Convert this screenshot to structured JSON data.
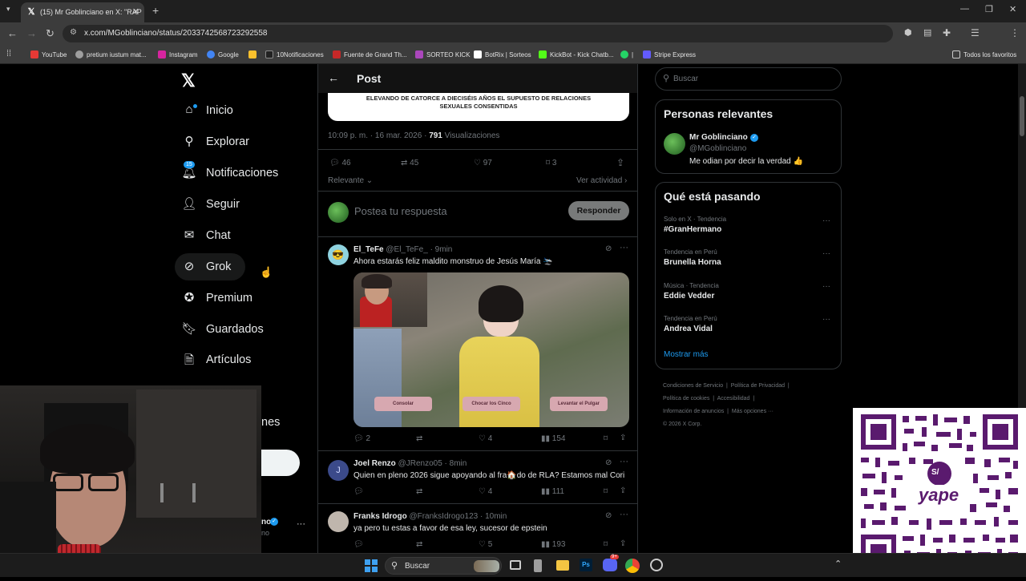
{
  "browser": {
    "tab_title": "(15) Mr Goblinciano en X: \"RAP",
    "url": "x.com/MGoblinciano/status/2033742568723292558",
    "bookmarks": [
      "YouTube",
      "pretium iustum mat...",
      "Instagram",
      "Google",
      "10Notificaciones",
      "Fuente de Grand Th...",
      "SORTEO KICK",
      "BotRix | Sorteos",
      "KickBot - Kick Chatb...",
      "Stripe Express"
    ],
    "bookmarks_folder": "Todos los favoritos"
  },
  "nav": {
    "items": [
      "Inicio",
      "Explorar",
      "Notificaciones",
      "Seguir",
      "Chat",
      "Grok",
      "Premium",
      "Guardados",
      "Artículos"
    ],
    "notif_count": "15",
    "partial_more": "nes",
    "profile_suffix": "no",
    "profile_sub": "no",
    "more_dots": "···"
  },
  "post": {
    "header": "Post",
    "image_text": "ELEVANDO DE CATORCE A DIECISÉIS AÑOS EL SUPUESTO DE RELACIONES SEXUALES CONSENTIDAS",
    "meta_time": "10:09 p. m. · 16 mar. 2026 · ",
    "views_count": "791",
    "views_label": "Visualizaciones",
    "replies": "46",
    "reposts": "45",
    "likes": "97",
    "bookmarks": "3",
    "sort_label": "Relevante",
    "activity_label": "Ver actividad",
    "reply_placeholder": "Postea tu respuesta",
    "reply_button": "Responder"
  },
  "replies": [
    {
      "name": "El_TeFe",
      "handle": "@El_TeFe_ · 9min",
      "text": "Ahora estarás feliz maldito monstruo de Jesús María 🛬",
      "media_buttons": [
        "Consolar",
        "Chocar los Cinco",
        "Levantar el Pulgar"
      ],
      "replies": "2",
      "reposts": "",
      "likes": "4",
      "views": "154"
    },
    {
      "name": "Joel Renzo",
      "handle": "@JRenzo05 · 8min",
      "text": "Quien en pleno 2026 sigue apoyando al fra🏠do de RLA? Estamos mal Cori",
      "replies": "",
      "reposts": "",
      "likes": "4",
      "views": "111"
    },
    {
      "name": "Franks Idrogo",
      "handle": "@FranksIdrogo123 · 10min",
      "text": "ya pero tu estas a favor de esa ley, sucesor de epstein",
      "replies": "",
      "reposts": "",
      "likes": "5",
      "views": "193"
    }
  ],
  "sidebar": {
    "search_placeholder": "Buscar",
    "relevant_title": "Personas relevantes",
    "person_name": "Mr Goblinciano",
    "person_handle": "@MGoblinciano",
    "person_bio": "Me odian por decir la verdad 👍",
    "trends_title": "Qué está pasando",
    "trends": [
      {
        "context": "Solo en X · Tendencia",
        "name": "#GranHermano"
      },
      {
        "context": "Tendencia en Perú",
        "name": "Brunella Horna"
      },
      {
        "context": "Música · Tendencia",
        "name": "Eddie Vedder"
      },
      {
        "context": "Tendencia en Perú",
        "name": "Andrea Vidal"
      }
    ],
    "show_more": "Mostrar más",
    "footer": [
      "Condiciones de Servicio",
      "Política de Privacidad",
      "Política de cookies",
      "Accesibilidad",
      "Información de anuncios",
      "Más opciones ···",
      "© 2026 X Corp."
    ]
  },
  "taskbar": {
    "search": "Buscar",
    "discord_badge": "9+"
  },
  "overlay": {
    "qr_brand": "yape",
    "qr_currency": "S/"
  },
  "colors": {
    "accent": "#1d9bf0",
    "verified": "#1d9bf0",
    "qr_purple": "#5a1a6e"
  }
}
